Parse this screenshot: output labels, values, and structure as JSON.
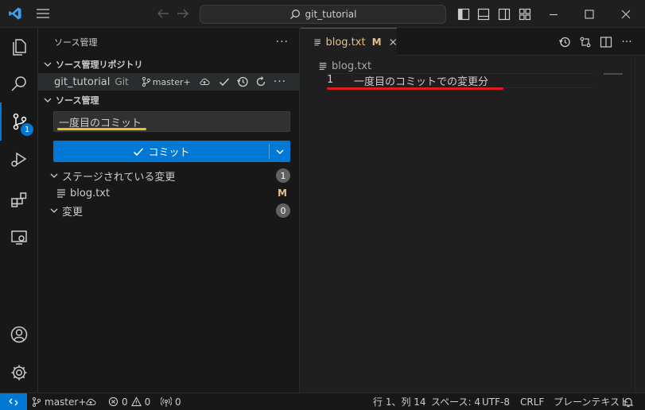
{
  "titlebar": {
    "search_text": "git_tutorial"
  },
  "activity": {
    "scm_badge": "1"
  },
  "sidebar": {
    "title": "ソース管理",
    "repos_header": "ソース管理リポジトリ",
    "repo_name": "git_tutorial",
    "repo_type": "Git",
    "repo_branch": "master+",
    "scm_header": "ソース管理",
    "commit_message": "一度目のコミット",
    "commit_button": "コミット",
    "staged_label": "ステージされている変更",
    "staged_count": "1",
    "staged_file": "blog.txt",
    "staged_file_status": "M",
    "changes_label": "変更",
    "changes_count": "0"
  },
  "editor": {
    "tab_label": "blog.txt",
    "tab_status": "M",
    "breadcrumb": "blog.txt",
    "line_number": "1",
    "line_text": "一度目のコミットでの変更分"
  },
  "statusbar": {
    "branch": "master+",
    "errors": "0",
    "warnings": "0",
    "ports": "0",
    "position": "行 1、列 14",
    "spaces": "スペース: 4",
    "encoding": "UTF-8",
    "eol": "CRLF",
    "language": "プレーンテキスト"
  },
  "colors": {
    "accent": "#0078d4",
    "underline_yellow": "#f0c020",
    "underline_red": "#e01b24",
    "badge_blue": "#0078d4"
  }
}
